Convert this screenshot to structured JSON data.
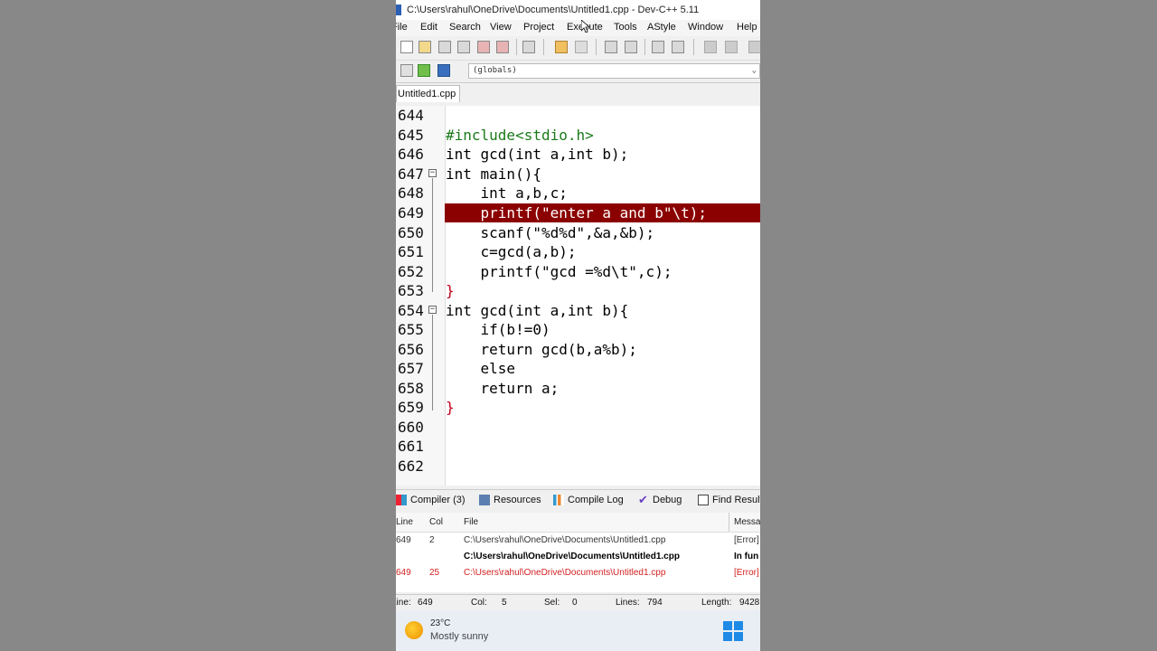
{
  "window": {
    "title": "C:\\Users\\rahul\\OneDrive\\Documents\\Untitled1.cpp - Dev-C++ 5.11"
  },
  "menu": [
    "File",
    "Edit",
    "Search",
    "View",
    "Project",
    "Execute",
    "Tools",
    "AStyle",
    "Window",
    "Help"
  ],
  "scope_dropdown": {
    "value": "(globals)"
  },
  "file_tab": {
    "label": "Untitled1.cpp"
  },
  "editor": {
    "highlight_line": "649",
    "lines": [
      {
        "n": "644",
        "text": ""
      },
      {
        "n": "645",
        "text": "#include<stdio.h>"
      },
      {
        "n": "646",
        "text": "int gcd(int a,int b);"
      },
      {
        "n": "647",
        "text": "int main(){"
      },
      {
        "n": "648",
        "text": "    int a,b,c;"
      },
      {
        "n": "649",
        "text": "    printf(\"enter a and b\"\\t);"
      },
      {
        "n": "650",
        "text": "    scanf(\"%d%d\",&a,&b);"
      },
      {
        "n": "651",
        "text": "    c=gcd(a,b);"
      },
      {
        "n": "652",
        "text": "    printf(\"gcd =%d\\t\",c);"
      },
      {
        "n": "653",
        "text": "}"
      },
      {
        "n": "654",
        "text": "int gcd(int a,int b){"
      },
      {
        "n": "655",
        "text": "    if(b!=0)"
      },
      {
        "n": "656",
        "text": "    return gcd(b,a%b);"
      },
      {
        "n": "657",
        "text": "    else"
      },
      {
        "n": "658",
        "text": "    return a;"
      },
      {
        "n": "659",
        "text": "}"
      },
      {
        "n": "660",
        "text": ""
      },
      {
        "n": "661",
        "text": ""
      },
      {
        "n": "662",
        "text": ""
      }
    ]
  },
  "bottom_tabs": [
    "Compiler (3)",
    "Resources",
    "Compile Log",
    "Debug",
    "Find Results"
  ],
  "messages": {
    "headers": {
      "line": "Line",
      "col": "Col",
      "file": "File",
      "message": "Message"
    },
    "rows": [
      {
        "line": "649",
        "col": "2",
        "file": "C:\\Users\\rahul\\OneDrive\\Documents\\Untitled1.cpp",
        "message": "[Error]",
        "color": "#333333",
        "bold": false
      },
      {
        "line": "",
        "col": "",
        "file": "C:\\Users\\rahul\\OneDrive\\Documents\\Untitled1.cpp",
        "message": "In fun",
        "color": "#000000",
        "bold": true
      },
      {
        "line": "649",
        "col": "25",
        "file": "C:\\Users\\rahul\\OneDrive\\Documents\\Untitled1.cpp",
        "message": "[Error]",
        "color": "#d42020",
        "bold": false
      }
    ]
  },
  "status": {
    "line_label": "Line:",
    "line": "649",
    "col_label": "Col:",
    "col": "5",
    "sel_label": "Sel:",
    "sel": "0",
    "lines_label": "Lines:",
    "lines": "794",
    "length_label": "Length:",
    "length": "9428"
  },
  "taskbar": {
    "temp": "23°C",
    "condition": "Mostly sunny"
  }
}
